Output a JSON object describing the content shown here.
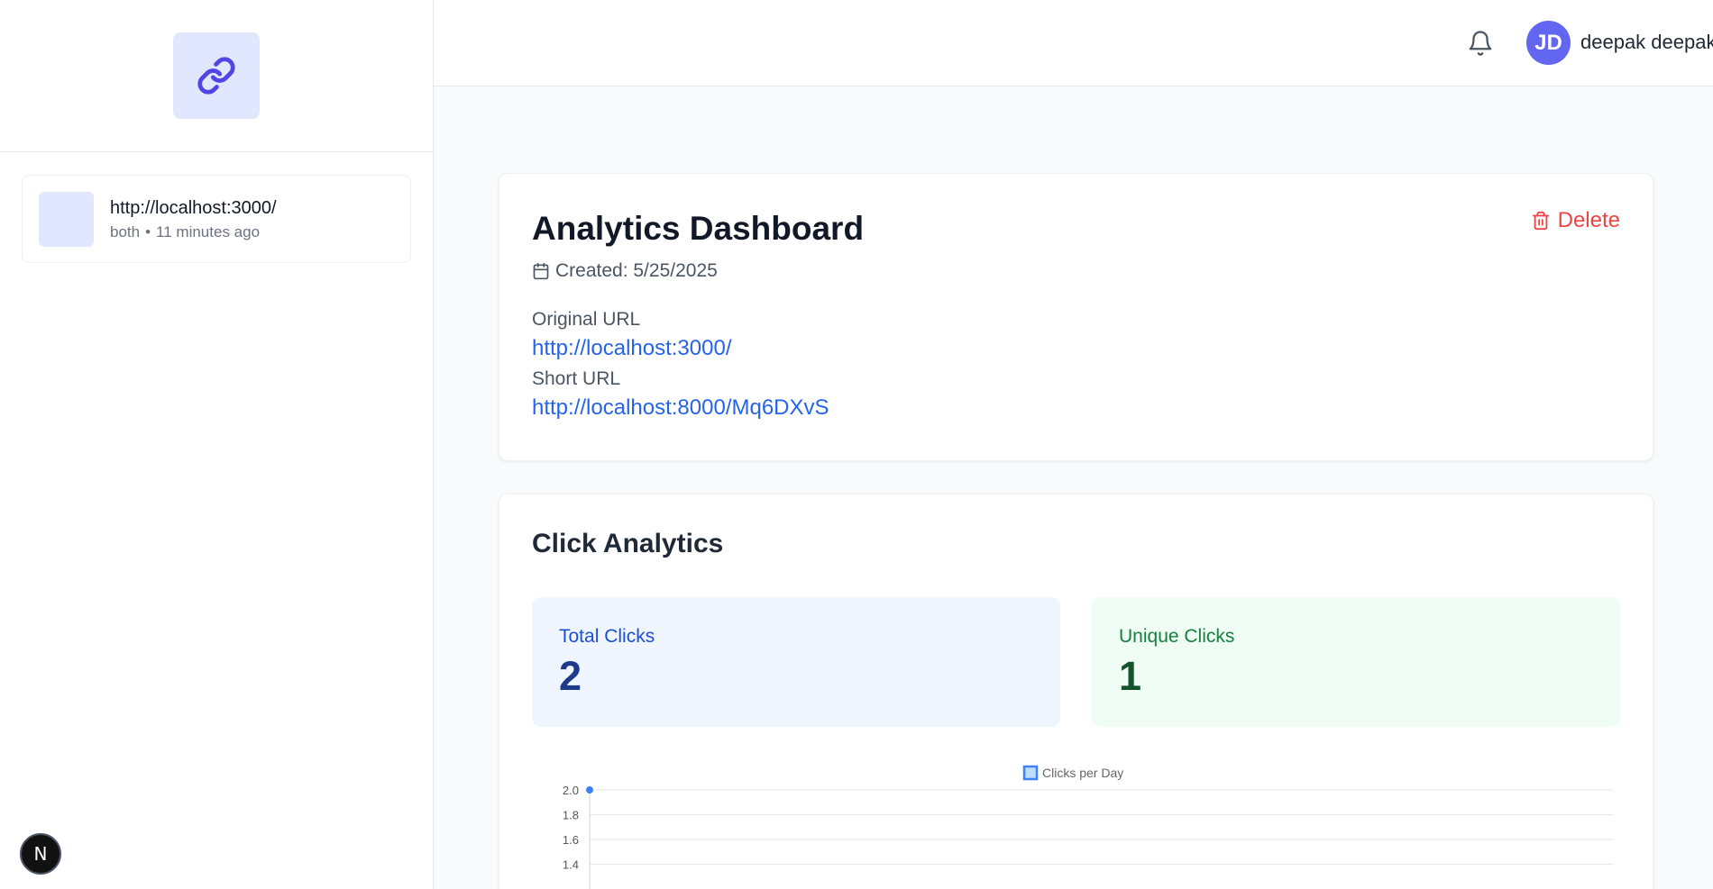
{
  "sidebar": {
    "links": [
      {
        "url": "http://localhost:3000/",
        "type": "both",
        "separator": "•",
        "time": "11 minutes ago"
      }
    ],
    "badge": "N"
  },
  "header": {
    "avatar_initials": "JD",
    "user_name": "deepak deepak"
  },
  "details": {
    "title": "Analytics Dashboard",
    "delete_label": "Delete",
    "created_text": "Created: 5/25/2025",
    "original_url_label": "Original URL",
    "original_url": "http://localhost:3000/",
    "short_url_label": "Short URL",
    "short_url": "http://localhost:8000/Mq6DXvS"
  },
  "analytics": {
    "title": "Click Analytics",
    "total_clicks_label": "Total Clicks",
    "total_clicks": "2",
    "unique_clicks_label": "Unique Clicks",
    "unique_clicks": "1"
  },
  "chart_data": {
    "type": "line",
    "series": [
      {
        "name": "Clicks per Day",
        "values": [
          2.0
        ]
      }
    ],
    "y_ticks": [
      "2.0",
      "1.8",
      "1.6",
      "1.4"
    ],
    "ylim": [
      1.4,
      2.0
    ],
    "grid": true,
    "legend": "top-center",
    "color": "#3b82f6"
  },
  "colors": {
    "accent": "#6366f1",
    "link": "#2563eb",
    "danger": "#ef4444"
  }
}
